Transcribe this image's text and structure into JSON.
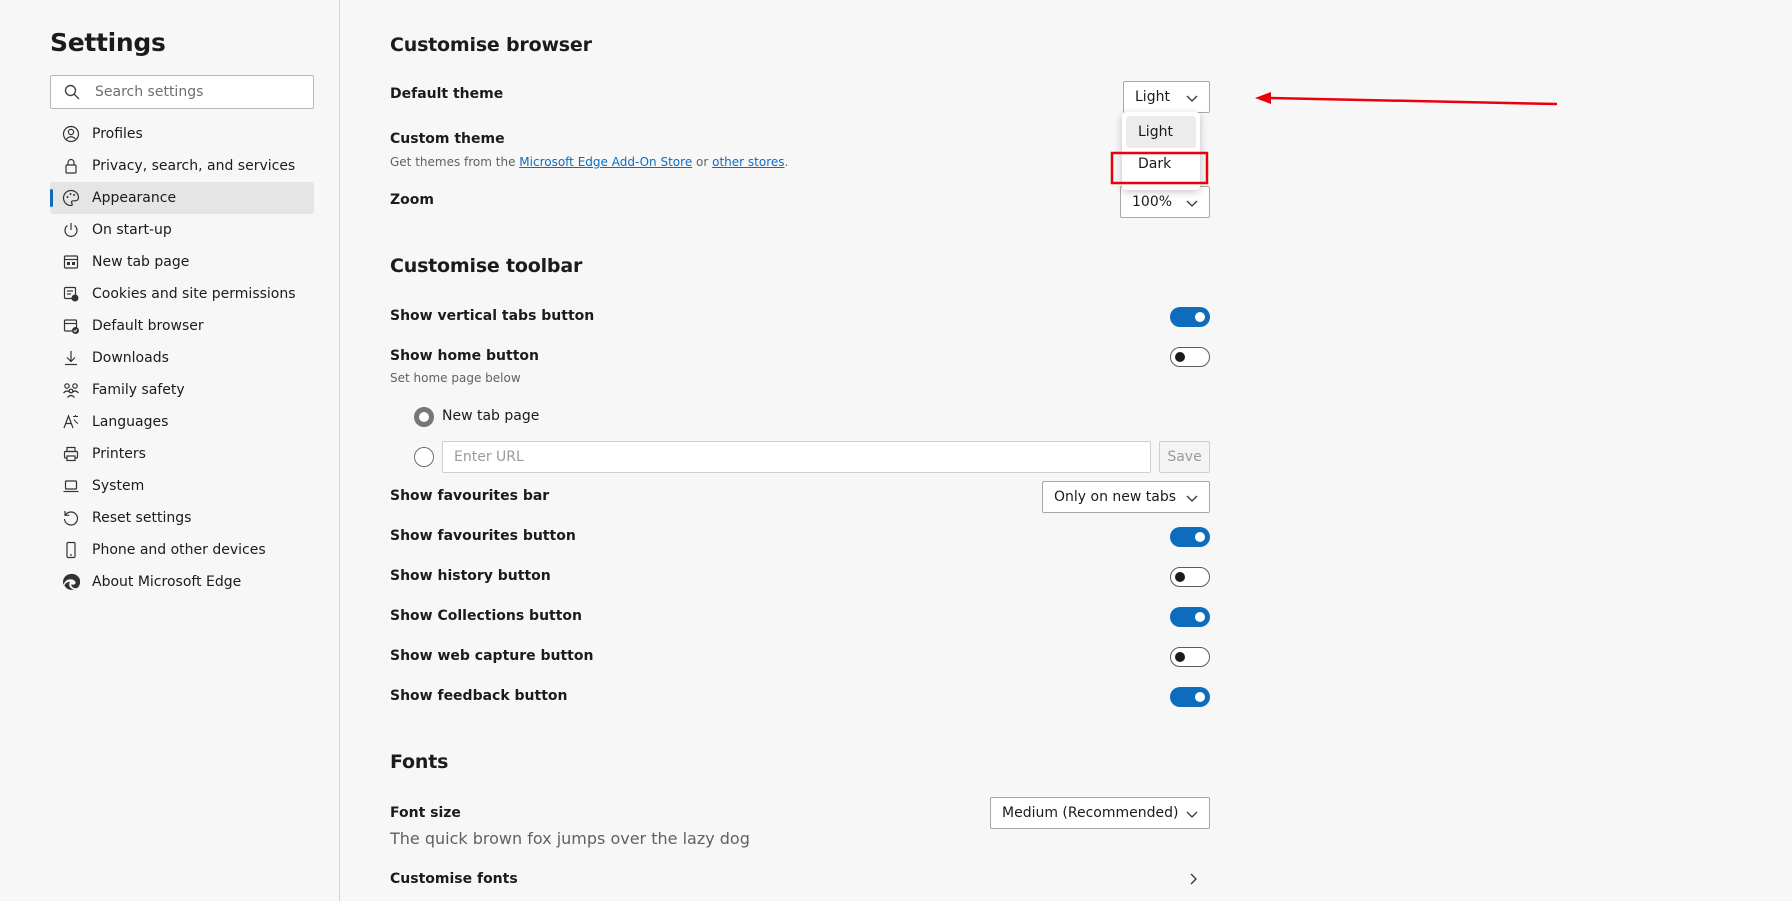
{
  "sidebar": {
    "title": "Settings",
    "search_placeholder": "Search settings",
    "items": [
      {
        "label": "Profiles"
      },
      {
        "label": "Privacy, search, and services"
      },
      {
        "label": "Appearance"
      },
      {
        "label": "On start-up"
      },
      {
        "label": "New tab page"
      },
      {
        "label": "Cookies and site permissions"
      },
      {
        "label": "Default browser"
      },
      {
        "label": "Downloads"
      },
      {
        "label": "Family safety"
      },
      {
        "label": "Languages"
      },
      {
        "label": "Printers"
      },
      {
        "label": "System"
      },
      {
        "label": "Reset settings"
      },
      {
        "label": "Phone and other devices"
      },
      {
        "label": "About Microsoft Edge"
      }
    ],
    "active_item": "Appearance"
  },
  "browser": {
    "title": "Customise browser",
    "default_theme": {
      "label": "Default theme",
      "value": "Light",
      "options": [
        "Light",
        "Dark"
      ],
      "highlighted_option": "Light"
    },
    "custom_theme": {
      "label": "Custom theme",
      "desc_prefix": "Get themes from the ",
      "link1": "Microsoft Edge Add-On Store",
      "desc_mid": " or ",
      "link2": "other stores",
      "desc_suffix": "."
    },
    "zoom": {
      "label": "Zoom",
      "value": "100%"
    }
  },
  "toolbar": {
    "title": "Customise toolbar",
    "vertical_tabs": {
      "label": "Show vertical tabs button",
      "on": true
    },
    "home": {
      "label": "Show home button",
      "desc": "Set home page below",
      "on": false
    },
    "home_options": {
      "new_tab": "New tab page",
      "url_placeholder": "Enter URL",
      "save": "Save"
    },
    "favourites_bar": {
      "label": "Show favourites bar",
      "value": "Only on new tabs"
    },
    "favourites_button": {
      "label": "Show favourites button",
      "on": true
    },
    "history_button": {
      "label": "Show history button",
      "on": false
    },
    "collections_button": {
      "label": "Show Collections button",
      "on": true
    },
    "web_capture_button": {
      "label": "Show web capture button",
      "on": false
    },
    "feedback_button": {
      "label": "Show feedback button",
      "on": true
    }
  },
  "fonts": {
    "title": "Fonts",
    "font_size": {
      "label": "Font size",
      "value": "Medium (Recommended)"
    },
    "sample": "The quick brown fox jumps over the lazy dog",
    "customise": {
      "label": "Customise fonts"
    }
  },
  "colors": {
    "accent": "#0f6cbd",
    "annotation": "#e8000b"
  }
}
